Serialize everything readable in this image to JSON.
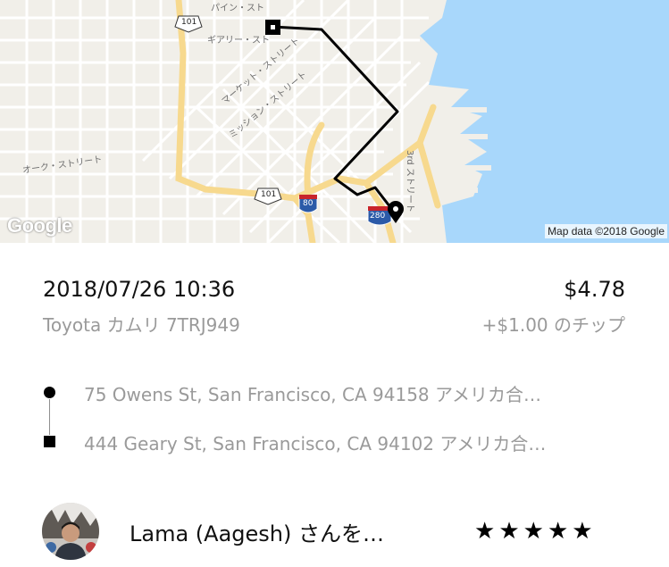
{
  "map": {
    "labels": {
      "pine_st": "パイン・スト",
      "geary_st": "ギアリー・スト",
      "market_st": "マーケット・ストリート",
      "mission_st": "ミッション・ストリート",
      "oak_st": "オーク・ストリート",
      "third_st": "3rd ストリート",
      "hwy_101_top": "101",
      "hwy_101_bottom": "101",
      "i80": "80",
      "i280": "280"
    },
    "google_logo": "Google",
    "attribution": "Map data ©2018 Google"
  },
  "trip": {
    "datetime": "2018/07/26 10:36",
    "fare": "$4.78",
    "vehicle": "Toyota カムリ 7TRJ949",
    "tip": "+$1.00 のチップ"
  },
  "route": {
    "pickup": "75 Owens St, San Francisco, CA 94158 アメリカ合…",
    "dropoff": "444 Geary St, San Francisco, CA 94102 アメリカ合…"
  },
  "driver": {
    "name": "Lama (Aagesh) さんを…",
    "rating": 5,
    "stars": [
      "★",
      "★",
      "★",
      "★",
      "★"
    ]
  },
  "colors": {
    "water": "#a8d7fb",
    "land": "#f1efe9",
    "highway": "#f7d98e",
    "route": "#000000",
    "secondary_text": "#9a9a9a"
  }
}
